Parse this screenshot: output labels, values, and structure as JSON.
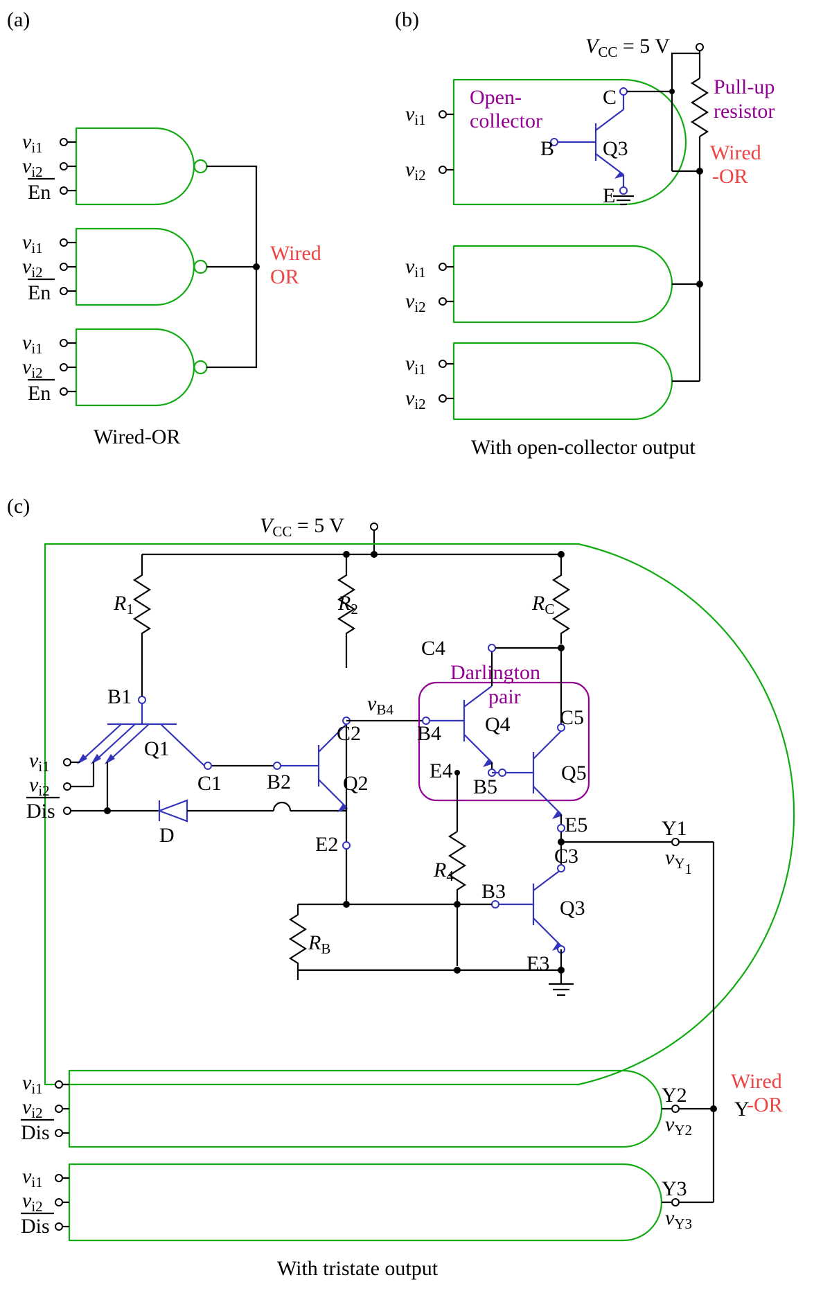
{
  "panels": {
    "a": "(a)",
    "b": "(b)",
    "c": "(c)"
  },
  "labels": {
    "vi1": "v",
    "vi1_sub": "i1",
    "vi2": "v",
    "vi2_sub": "i2",
    "en": "En",
    "dis": "Dis",
    "wiredOR": "Wired-OR",
    "wiredOR_caption_a": "Wired-OR",
    "wired_line1": "Wired",
    "wired_line2": "-OR",
    "vcc": "V",
    "vcc_sub": "CC",
    "vcc_eq": " = 5 V",
    "open_collector_l1": "Open-",
    "open_collector_l2": "collector",
    "pullup_l1": "Pull-up",
    "pullup_l2": "resistor",
    "with_oc": "With open-collector output",
    "with_tristate": "With tristate output",
    "B": "B",
    "C": "C",
    "E": "E",
    "Q1": "Q1",
    "Q2": "Q2",
    "Q3": "Q3",
    "Q4": "Q4",
    "Q5": "Q5",
    "R1": "R",
    "R1_sub": "1",
    "R2": "R",
    "R2_sub": "2",
    "RC": "R",
    "RC_sub": "C",
    "R4": "R",
    "R4_sub": "4",
    "RB": "R",
    "RB_sub": "B",
    "D": "D",
    "darlington_l1": "Darlington",
    "darlington_l2": "pair",
    "B1": "B1",
    "C1": "C1",
    "B2": "B2",
    "C2": "C2",
    "E2": "E2",
    "B3": "B3",
    "C3": "C3",
    "E3": "E3",
    "B4": "B4",
    "C4": "C4",
    "E4": "E4",
    "B5": "B5",
    "C5": "C5",
    "E5": "E5",
    "vB4": "v",
    "vB4_sub": "B4",
    "Y": "Y",
    "Y1": "Y1",
    "Y2": "Y2",
    "Y3": "Y3",
    "vY1": "v",
    "vY1_sub": "Y",
    "vY1_sub2": "1",
    "vY2": "v",
    "vY2_sub": "Y2",
    "vY3": "v",
    "vY3_sub": "Y3"
  }
}
